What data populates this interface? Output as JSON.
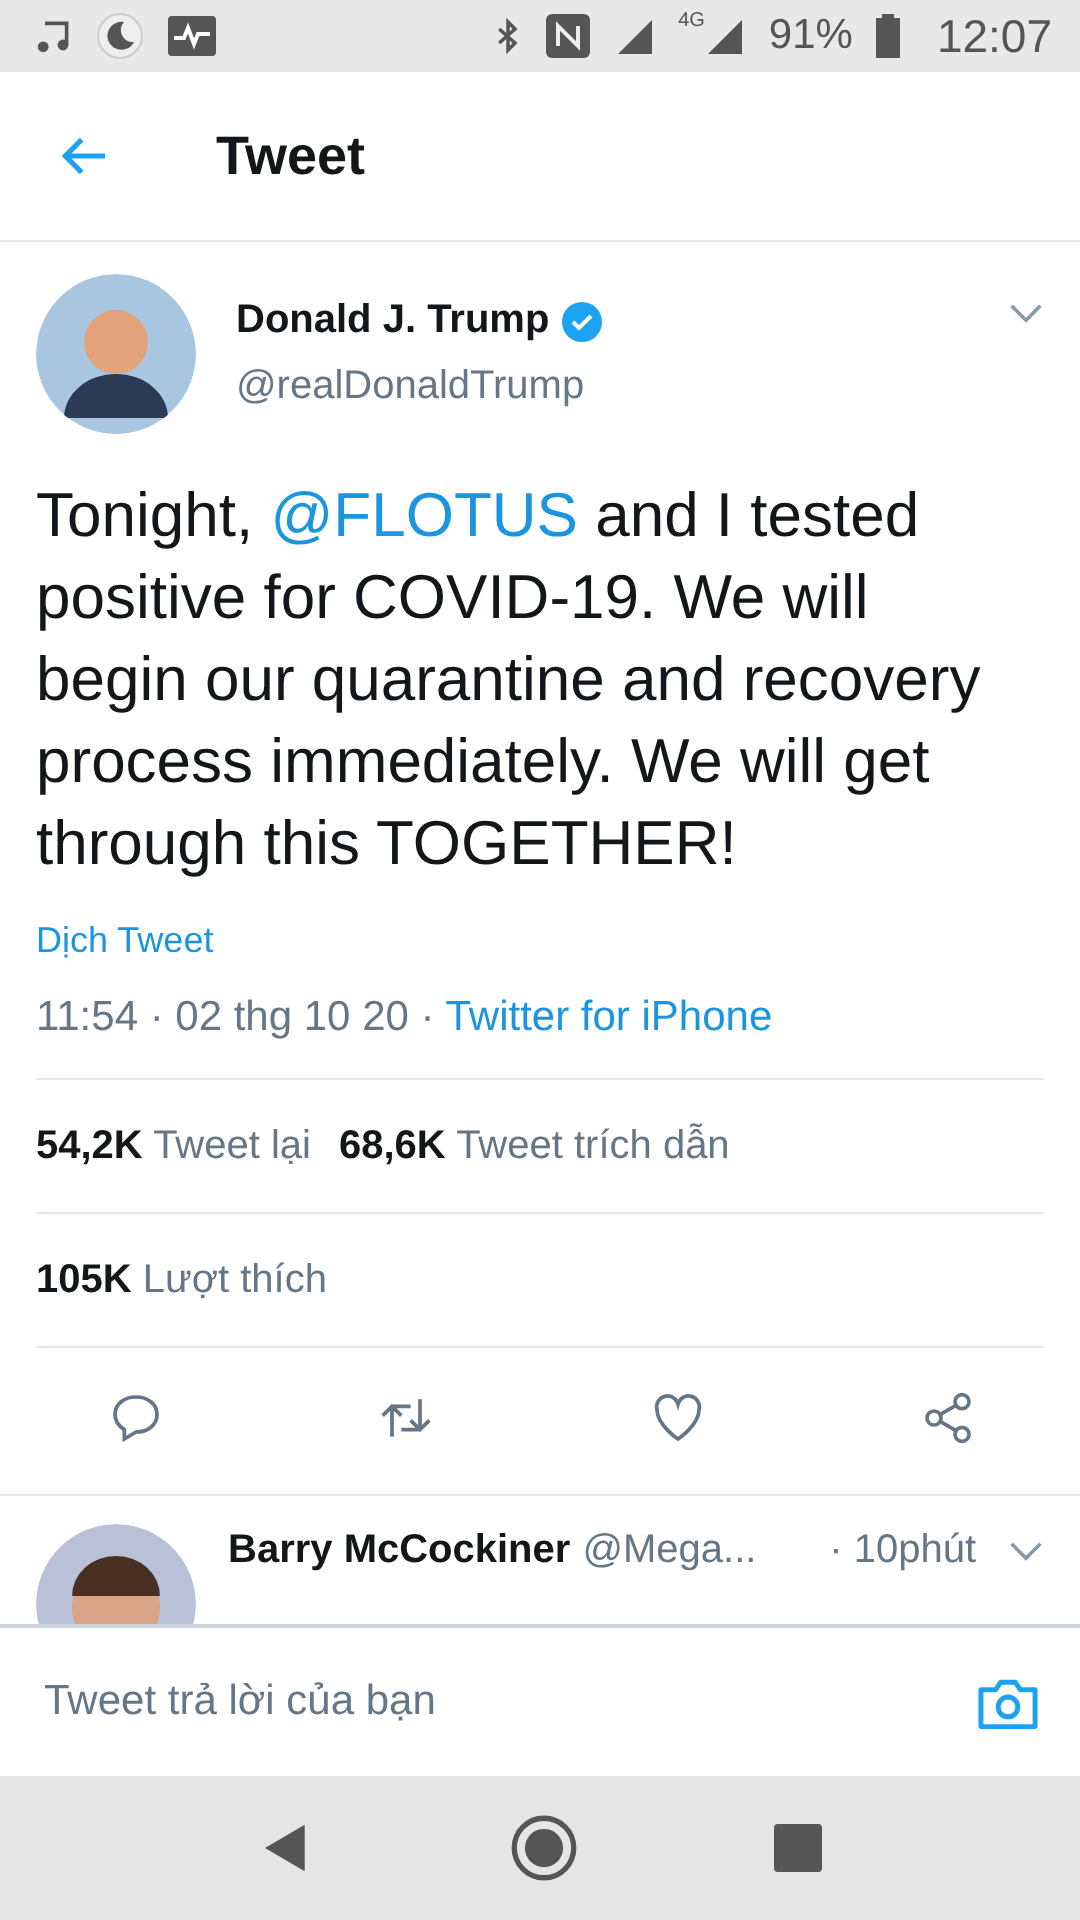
{
  "status_bar": {
    "battery": "91%",
    "time": "12:07",
    "network": "4G"
  },
  "header": {
    "title": "Tweet"
  },
  "tweet": {
    "name": "Donald J. Trump",
    "verified": true,
    "handle": "@realDonaldTrump",
    "text_parts": [
      {
        "kind": "text",
        "text": "Tonight, "
      },
      {
        "kind": "mention",
        "text": "@FLOTUS"
      },
      {
        "kind": "text",
        "text": " and I tested positive for COVID-19. We will begin our quarantine and recovery process immediately. We will get through this TOGETHER!"
      }
    ],
    "translate": "Dịch Tweet",
    "timestamp": "11:54 · 02 thg 10 20 ·",
    "source": "Twitter for iPhone",
    "stats_row": [
      {
        "count": "54,2K",
        "label": "Tweet lại"
      },
      {
        "count": "68,6K",
        "label": "Tweet trích dẫn"
      }
    ],
    "likes": {
      "count": "105K",
      "label": "Lượt thích"
    }
  },
  "reply": {
    "name": "Barry McCockiner",
    "handle": "@Mega...",
    "time": "· 10phút"
  },
  "composer": {
    "placeholder": "Tweet trả lời của bạn"
  }
}
